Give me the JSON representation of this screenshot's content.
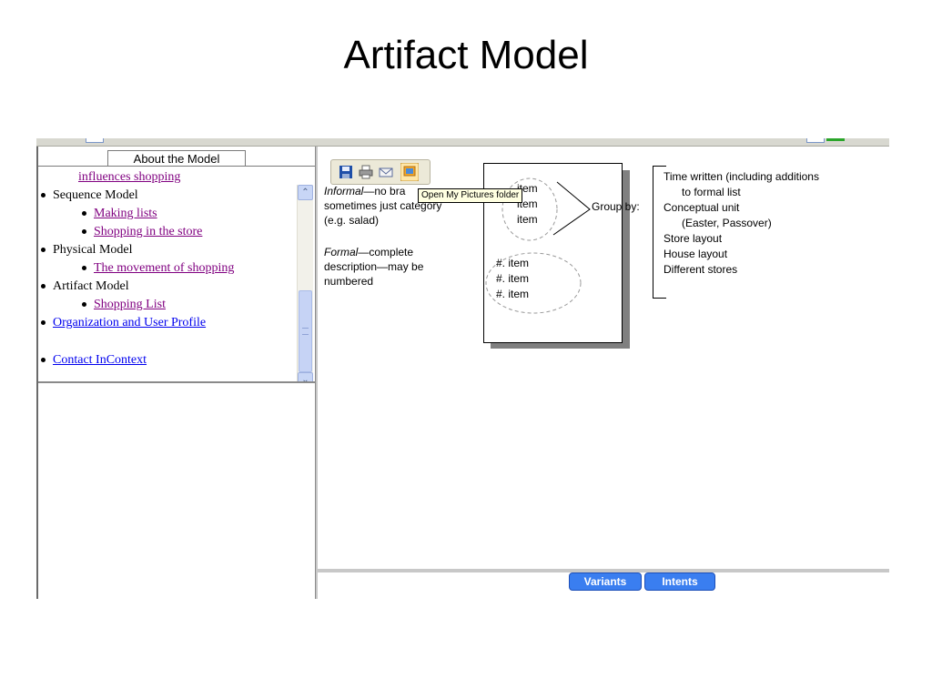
{
  "slide": {
    "title": "Artifact Model"
  },
  "left_panel": {
    "tab_label": "About the Model",
    "tree": [
      {
        "label": "influences shopping",
        "level": 1,
        "link": true,
        "visited": true,
        "bullet": false
      },
      {
        "label": "Sequence Model",
        "level": 0,
        "link": false,
        "bullet": true
      },
      {
        "label": "Making lists",
        "level": 1,
        "link": true,
        "visited": true,
        "bullet": true
      },
      {
        "label": "Shopping in the store",
        "level": 1,
        "link": true,
        "visited": true,
        "bullet": true
      },
      {
        "label": "Physical Model",
        "level": 0,
        "link": false,
        "bullet": true
      },
      {
        "label": "The movement of shopping",
        "level": 1,
        "link": true,
        "visited": true,
        "bullet": true
      },
      {
        "label": "Artifact Model",
        "level": 0,
        "link": false,
        "bullet": true
      },
      {
        "label": "Shopping List",
        "level": 1,
        "link": true,
        "visited": true,
        "bullet": true
      },
      {
        "label": "Organization and User Profile",
        "level": 0,
        "link": true,
        "visited": false,
        "bullet": true
      },
      {
        "label": "",
        "level": 0,
        "link": false,
        "bullet": false
      },
      {
        "label": "Contact InContext",
        "level": 0,
        "link": true,
        "visited": false,
        "bullet": true
      }
    ],
    "scroll_up_glyph": "⌃",
    "scroll_down_glyph": "⌄"
  },
  "toolbar": {
    "icons": [
      "save-icon",
      "print-icon",
      "email-icon",
      "open-pictures-folder-icon"
    ],
    "tooltip": "Open My Pictures folder"
  },
  "diagram": {
    "informal": {
      "term": "Informal",
      "text": "—no bra",
      "rest": "sometimes just category",
      "rest2": "(e.g. salad)"
    },
    "formal": {
      "term": "Formal",
      "text": "—complete",
      "rest": "description—may be",
      "rest2": "numbered"
    },
    "informal_items": [
      "item",
      "item",
      "item"
    ],
    "formal_items": [
      "#. item",
      "#. item",
      "#. item"
    ],
    "group_by_label": "Group by:",
    "criteria": [
      "Time written (including additions",
      "    to formal list",
      "Conceptual unit",
      "    (Easter, Passover)",
      "Store layout",
      "House layout",
      "Different stores"
    ]
  },
  "bottom_tabs": [
    "Variants",
    "Intents"
  ],
  "colors": {
    "visited_link": "#800080",
    "link": "#0000ee",
    "tab_button": "#3a7ef0",
    "tooltip_bg": "#ffffe1"
  }
}
